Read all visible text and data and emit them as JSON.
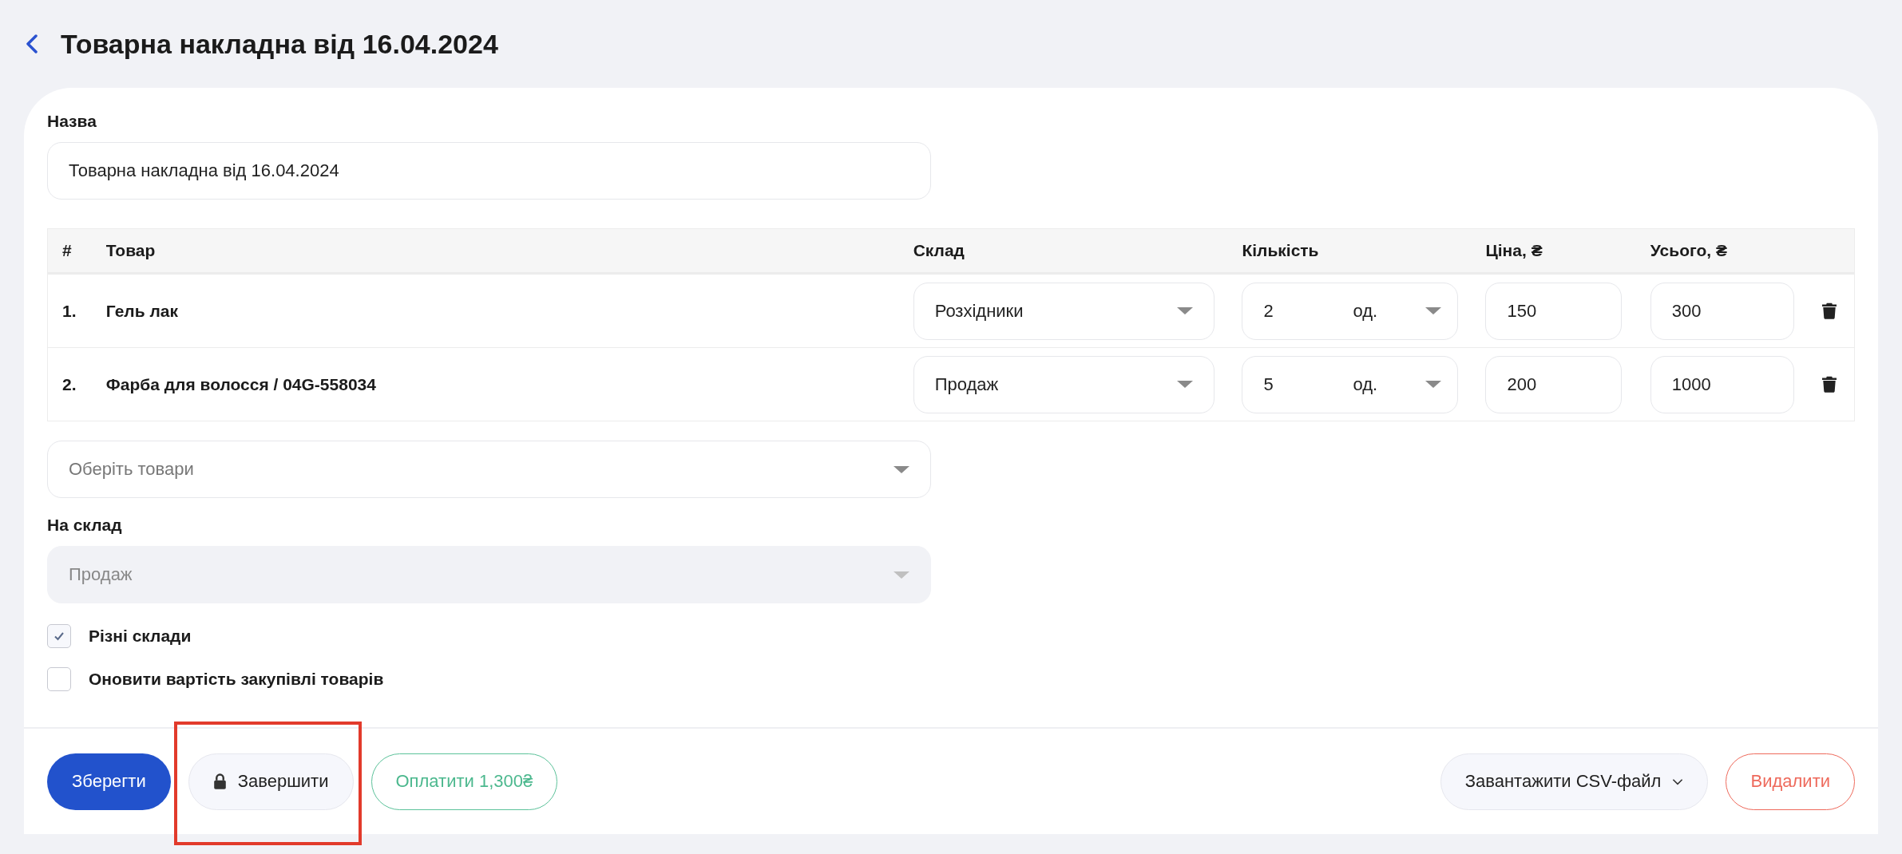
{
  "header": {
    "title": "Товарна накладна від 16.04.2024"
  },
  "name_field": {
    "label": "Назва",
    "value": "Товарна накладна від 16.04.2024"
  },
  "table": {
    "columns": [
      "#",
      "Товар",
      "Склад",
      "Кількість",
      "Ціна, ₴",
      "Усього, ₴"
    ],
    "rows": [
      {
        "number": "1.",
        "product": "Гель лак",
        "warehouse": "Розхідники",
        "quantity": "2",
        "unit": "од.",
        "price": "150",
        "total": "300"
      },
      {
        "number": "2.",
        "product": "Фарба для волосся / 04G-558034",
        "warehouse": "Продаж",
        "quantity": "5",
        "unit": "од.",
        "price": "200",
        "total": "1000"
      }
    ]
  },
  "product_picker": {
    "placeholder": "Оберіть товари"
  },
  "target_warehouse": {
    "label": "На склад",
    "value": "Продаж",
    "disabled": true
  },
  "checkboxes": [
    {
      "label": "Різні склади",
      "checked": true
    },
    {
      "label": "Оновити вартість закупівлі товарів",
      "checked": false
    }
  ],
  "buttons": [
    {
      "kind": "primary",
      "label": "Зберегти",
      "highlighted": false
    },
    {
      "kind": "lock",
      "label": "Завершити",
      "highlighted": true
    },
    {
      "kind": "pay",
      "label": "Оплатити 1,300₴",
      "highlighted": false
    },
    {
      "kind": "dropdown",
      "label": "Завантажити CSV-файл",
      "highlighted": false
    },
    {
      "kind": "danger",
      "label": "Видалити",
      "highlighted": false
    }
  ]
}
